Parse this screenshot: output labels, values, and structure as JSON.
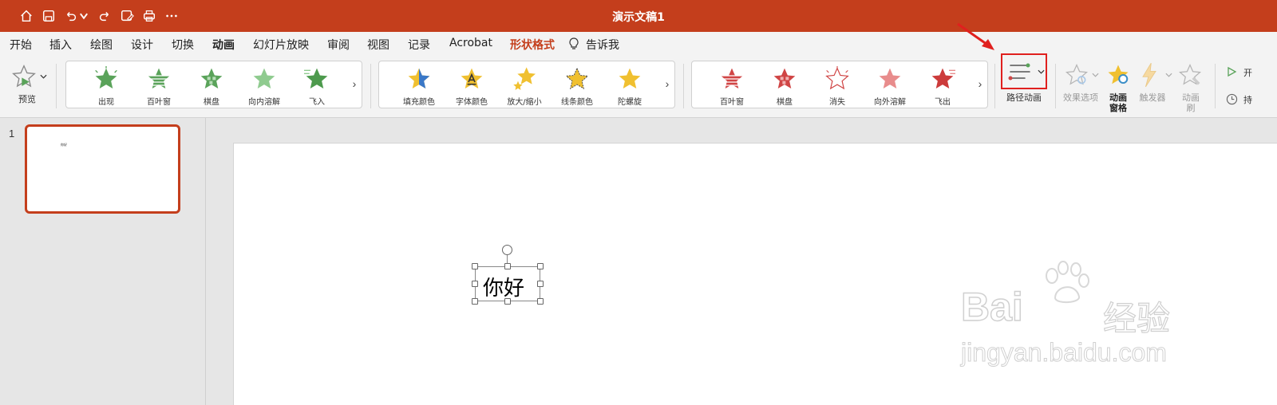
{
  "window": {
    "title": "演示文稿1"
  },
  "menu": {
    "tabs": [
      {
        "label": "开始"
      },
      {
        "label": "插入"
      },
      {
        "label": "绘图"
      },
      {
        "label": "设计"
      },
      {
        "label": "切换"
      },
      {
        "label": "动画"
      },
      {
        "label": "幻灯片放映"
      },
      {
        "label": "审阅"
      },
      {
        "label": "视图"
      },
      {
        "label": "记录"
      },
      {
        "label": "Acrobat"
      },
      {
        "label": "形状格式"
      }
    ],
    "tell_me": "告诉我"
  },
  "ribbon": {
    "preview_label": "预览",
    "entrance_effects": [
      "出现",
      "百叶窗",
      "棋盘",
      "向内溶解",
      "飞入"
    ],
    "emphasis_effects": [
      "填充颜色",
      "字体颜色",
      "放大/缩小",
      "线条颜色",
      "陀螺旋"
    ],
    "exit_effects": [
      "百叶窗",
      "棋盘",
      "消失",
      "向外溶解",
      "飞出"
    ],
    "motion_path_label": "路径动画",
    "effect_options_label": "效果选项",
    "animation_pane_label_1": "动画",
    "animation_pane_label_2": "窗格",
    "trigger_label": "触发器",
    "animation_painter_label_1": "动画",
    "animation_painter_label_2": "刷",
    "start_partial": "开",
    "duration_partial": "持"
  },
  "slides": [
    {
      "number": "1",
      "thumb_text": "你好"
    }
  ],
  "canvas": {
    "text_box": "你好"
  },
  "watermark": {
    "brand": "Bai",
    "brand_cn": "经验",
    "url": "jingyan.baidu.com"
  },
  "colors": {
    "accent": "#c43e1c",
    "entrance_star": "#5aa35a",
    "emphasis_star": "#f0c030",
    "exit_star": "#d04545",
    "highlight_box": "#e0201e"
  },
  "icons": {
    "quick_access": [
      "home-icon",
      "save-icon",
      "undo-icon",
      "redo-icon",
      "save-as-icon",
      "print-icon",
      "more-icon"
    ]
  }
}
